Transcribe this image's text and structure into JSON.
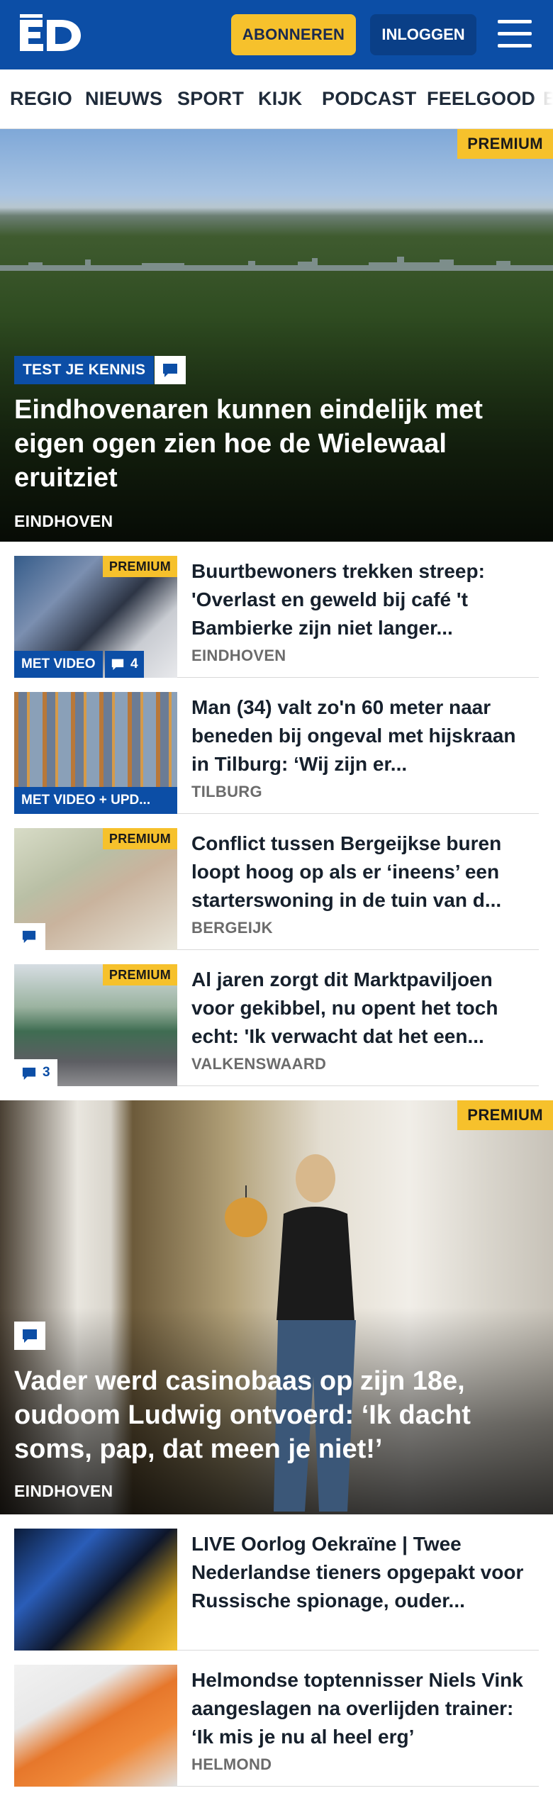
{
  "header": {
    "logo": "ED",
    "subscribe_label": "ABONNEREN",
    "login_label": "INLOGGEN",
    "colors": {
      "brand": "#0c4ea6",
      "accent": "#f6c12c"
    }
  },
  "nav": {
    "items": [
      "REGIO",
      "NIEUWS",
      "SPORT",
      "KIJK",
      "PODCAST",
      "FEELGOOD",
      "B"
    ]
  },
  "hero1": {
    "premium": "PREMIUM",
    "tag": "TEST JE KENNIS",
    "title": "Eindhovenaren kunnen eindelijk met eigen ogen zien hoe de Wielewaal eruitziet",
    "location": "EINDHOVEN"
  },
  "articles": [
    {
      "title": "Buurtbewoners trekken streep: 'Overlast en geweld bij café 't Bambierke zijn niet langer...",
      "location": "EINDHOVEN",
      "premium": "PREMIUM",
      "tag": "MET VIDEO",
      "comments": "4"
    },
    {
      "title": "Man (34) valt zo'n 60 meter naar beneden bij ongeval met hijskraan in Tilburg: ‘Wij zijn er...",
      "location": "TILBURG",
      "tag": "MET VIDEO + UPD..."
    },
    {
      "title": "Conflict tussen Bergeijkse buren loopt hoog op als er ‘ineens’ een starterswoning in de tuin van d...",
      "location": "BERGEIJK",
      "premium": "PREMIUM"
    },
    {
      "title": "Al jaren zorgt dit Marktpaviljoen voor gekibbel, nu opent het toch echt: 'Ik verwacht dat het een...",
      "location": "VALKENSWAARD",
      "premium": "PREMIUM",
      "comments": "3"
    }
  ],
  "hero2": {
    "premium": "PREMIUM",
    "title": "Vader werd casinobaas op zijn 18e, oudoom Ludwig ontvoerd: ‘Ik dacht soms, pap, dat meen je niet!’",
    "location": "EINDHOVEN"
  },
  "articles2": [
    {
      "title": "LIVE Oorlog Oekraïne | Twee Nederlandse tieners opgepakt voor Russische spionage, ouder...",
      "location": ""
    },
    {
      "title": "Helmondse toptennisser Niels Vink aangeslagen na overlijden trainer: ‘Ik mis je nu al heel erg’",
      "location": "HELMOND"
    }
  ]
}
